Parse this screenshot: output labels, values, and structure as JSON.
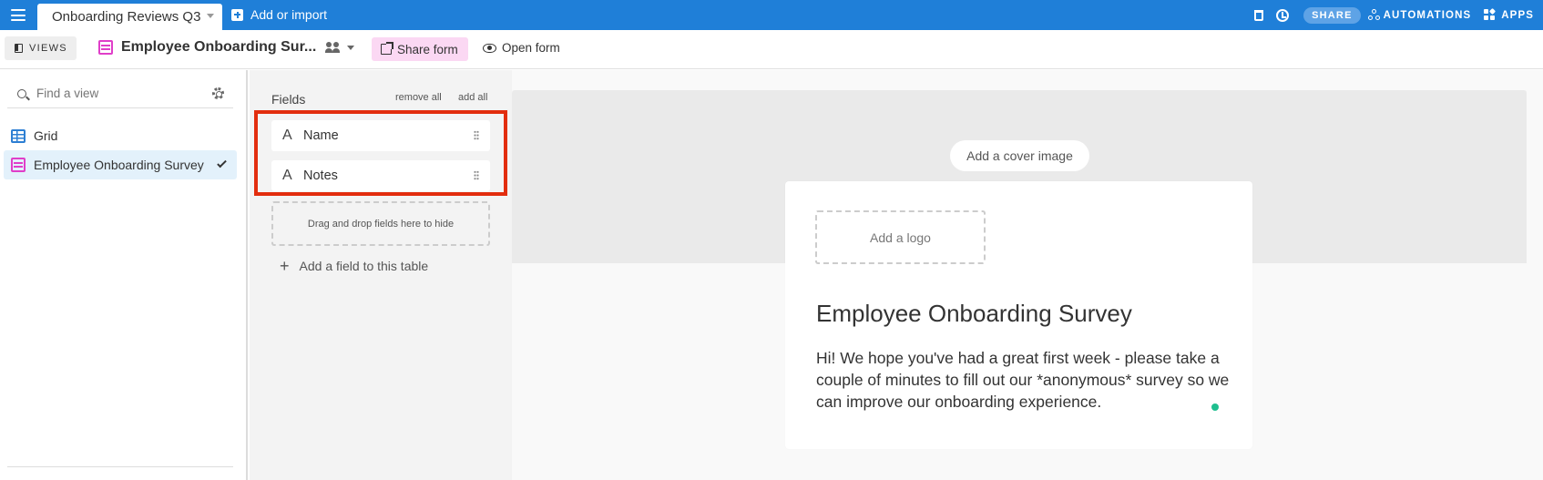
{
  "topbar": {
    "base_name": "Onboarding Reviews Q3",
    "add_import": "Add or import",
    "share": "SHARE",
    "automations": "AUTOMATIONS",
    "apps": "APPS",
    "color": "#1f7fd8"
  },
  "viewbar": {
    "views": "VIEWS",
    "view_title": "Employee Onboarding Sur...",
    "share_form": "Share form",
    "open_form": "Open form"
  },
  "sidebar": {
    "search_placeholder": "Find a view",
    "items": [
      {
        "label": "Grid",
        "icon": "grid-icon",
        "active": false
      },
      {
        "label": "Employee Onboarding Survey",
        "icon": "form-icon",
        "active": true
      }
    ]
  },
  "fields": {
    "header": "Fields",
    "remove_all": "remove all",
    "add_all": "add all",
    "list": [
      {
        "type_glyph": "A",
        "label": "Name"
      },
      {
        "type_glyph": "A",
        "label": "Notes"
      }
    ],
    "drop_zone": "Drag and drop fields here to hide",
    "add_field": "Add a field to this table"
  },
  "form": {
    "cover_button": "Add a cover image",
    "logo_button": "Add a logo",
    "title": "Employee Onboarding Survey",
    "description": "Hi! We hope you've had a great first week - please take a couple of minutes to fill out our *anonymous* survey so we can improve our onboarding experience."
  }
}
